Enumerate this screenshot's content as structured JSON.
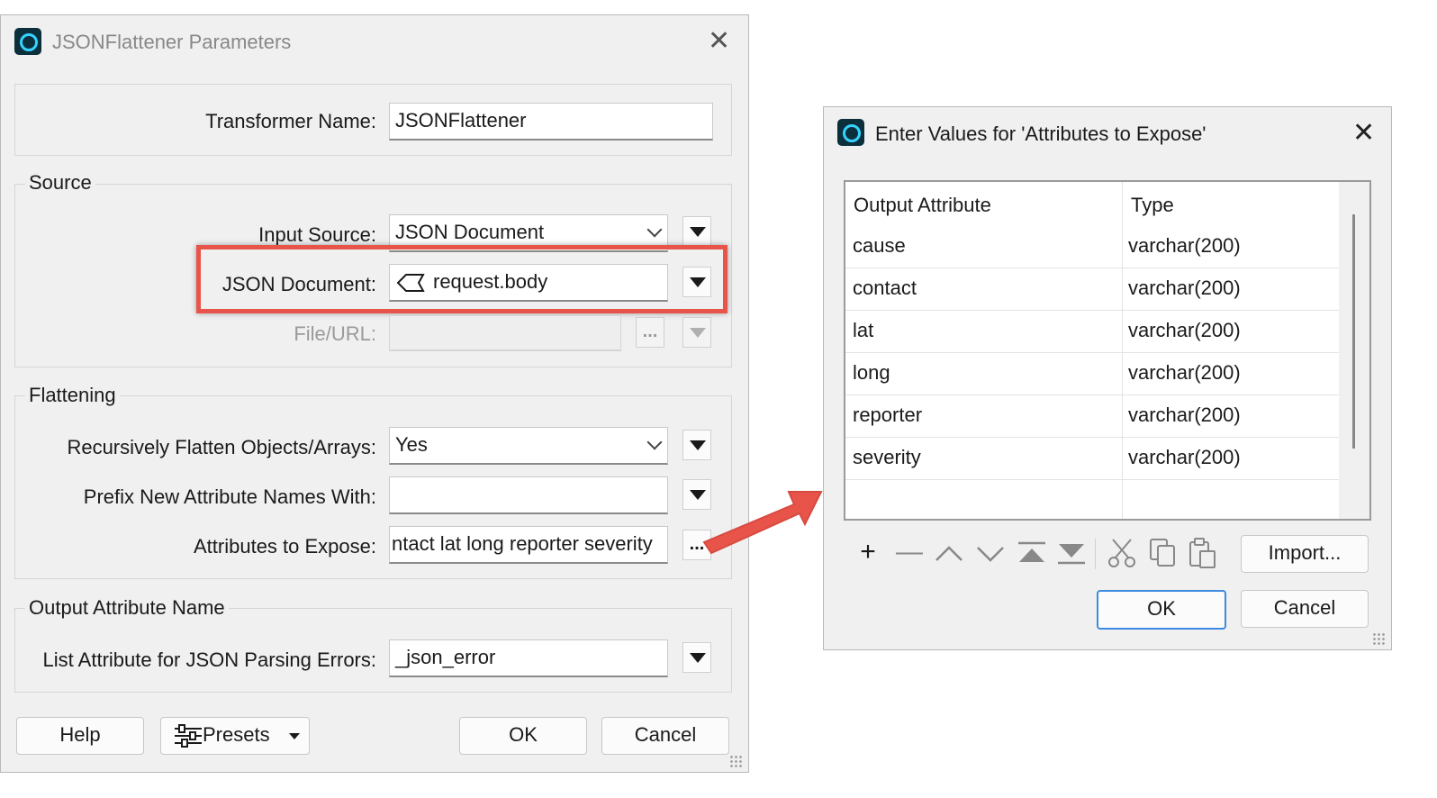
{
  "main_dialog": {
    "title": "JSONFlattener Parameters",
    "transformer_name": {
      "label": "Transformer Name:",
      "value": "JSONFlattener"
    },
    "source": {
      "group_label": "Source",
      "input_source": {
        "label": "Input Source:",
        "value": "JSON Document"
      },
      "json_document": {
        "label": "JSON Document:",
        "value": "request.body"
      },
      "file_url": {
        "label": "File/URL:",
        "value": "",
        "button": "..."
      }
    },
    "flattening": {
      "group_label": "Flattening",
      "recursive": {
        "label": "Recursively Flatten Objects/Arrays:",
        "value": "Yes"
      },
      "prefix": {
        "label": "Prefix New Attribute Names With:",
        "value": ""
      },
      "expose": {
        "label": "Attributes to Expose:",
        "value": "ntact lat long reporter severity",
        "button": "..."
      }
    },
    "output": {
      "group_label": "Output Attribute Name",
      "errors": {
        "label": "List Attribute for JSON Parsing Errors:",
        "value": "_json_error"
      }
    },
    "buttons": {
      "help": "Help",
      "presets": "Presets",
      "ok": "OK",
      "cancel": "Cancel"
    }
  },
  "values_dialog": {
    "title": "Enter Values for 'Attributes to Expose'",
    "columns": [
      "Output Attribute",
      "Type"
    ],
    "rows": [
      {
        "attribute": "cause",
        "type": "varchar(200)"
      },
      {
        "attribute": "contact",
        "type": "varchar(200)"
      },
      {
        "attribute": "lat",
        "type": "varchar(200)"
      },
      {
        "attribute": "long",
        "type": "varchar(200)"
      },
      {
        "attribute": "reporter",
        "type": "varchar(200)"
      },
      {
        "attribute": "severity",
        "type": "varchar(200)"
      }
    ],
    "toolbar": {
      "add": "+",
      "remove": "—"
    },
    "buttons": {
      "import": "Import...",
      "ok": "OK",
      "cancel": "Cancel"
    }
  },
  "colors": {
    "highlight": "#e8544a",
    "arrow": "#e8544a",
    "default_button_border": "#3c8be0"
  }
}
